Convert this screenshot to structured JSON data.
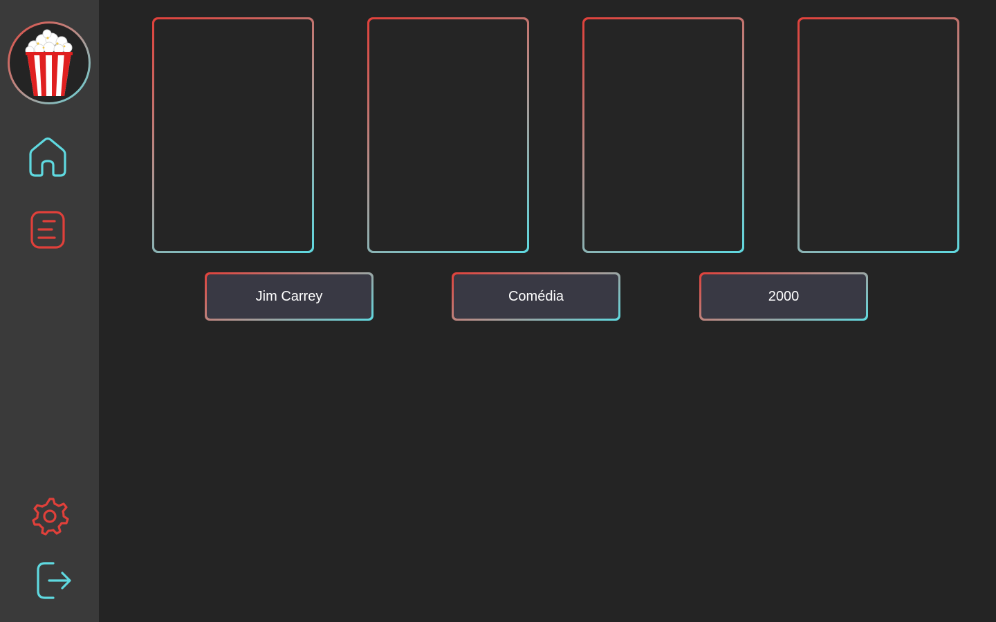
{
  "sidebar": {
    "logo": "popcorn-logo",
    "nav": [
      {
        "icon": "home-icon"
      },
      {
        "icon": "list-icon"
      }
    ],
    "bottom": [
      {
        "icon": "gear-icon"
      },
      {
        "icon": "logout-icon"
      }
    ]
  },
  "colors": {
    "background": "#242424",
    "sidebar": "#3a3a3a",
    "accent_red": "#e0403a",
    "accent_cyan": "#5fd9e0",
    "chip_fill": "#393944"
  },
  "main": {
    "posters": [
      {
        "icon": "poster-placeholder"
      },
      {
        "icon": "poster-placeholder"
      },
      {
        "icon": "poster-placeholder"
      },
      {
        "icon": "poster-placeholder"
      }
    ],
    "filters": [
      {
        "label": "Jim Carrey"
      },
      {
        "label": "Comédia"
      },
      {
        "label": "2000"
      }
    ]
  }
}
